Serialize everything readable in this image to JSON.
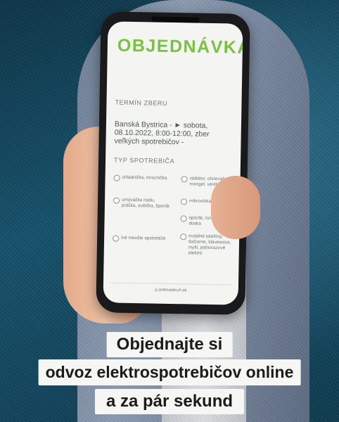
{
  "phone_screen": {
    "title": "OBJEDNÁVKA",
    "term_label": "TERMÍN ZBERU",
    "term_value": "Banská Bystrica - ► sobota, 08.10.2022, 8:00-12:00, zber veľkých spotrebičov -",
    "type_label": "TYP SPOTREBIČA",
    "options_left": [
      "chladnička, mraznička",
      "umývačka riadu, práčka, sušička, šporák",
      "iné menšie spotrebiče"
    ],
    "options_right": [
      "rádiátor, ohrievač, mangel, ventilátor",
      "mikrovlnka, mixér",
      "sporák, rúra, varná doska",
      "mobilné telefóny, tlačiarne, klávesnice, myši, jednorazové elektro"
    ],
    "footer_text": "a.zelenaokruh.sk"
  },
  "caption": {
    "line1": "Objednajte si",
    "line2": "odvoz elektrospotrebičov online",
    "line3": "a za pár sekund"
  },
  "colors": {
    "brand_green": "#7ac143",
    "background_teal": "#15506a",
    "caption_bg": "#f6f6f4"
  }
}
